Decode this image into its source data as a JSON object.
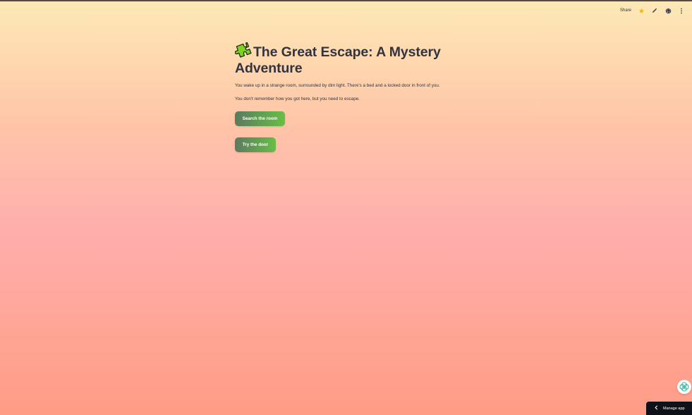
{
  "toolbar": {
    "share_label": "Share",
    "icons": [
      "star-icon",
      "pencil-icon",
      "github-icon",
      "more-vertical-icon"
    ],
    "star_color": "#f5b800"
  },
  "main": {
    "title": "The Great Escape: A Mystery Adventure",
    "title_icon": "puzzle-piece-icon",
    "paragraphs": [
      "You wake up in a strange room, surrounded by dim light. There's a bed and a locked door in front of you.",
      "You don't remember how you got here, but you need to escape."
    ],
    "buttons": [
      {
        "label": "Search the room"
      },
      {
        "label": "Try the door"
      }
    ]
  },
  "footer": {
    "manage_label": "Manage app",
    "assistant_icon": "assistant-swirl-icon"
  },
  "colors": {
    "button_gradient_start": "#5c7a5f",
    "button_gradient_end": "#66bf46",
    "manage_bg": "#0e1117",
    "puzzle_green": "#7ed321"
  }
}
